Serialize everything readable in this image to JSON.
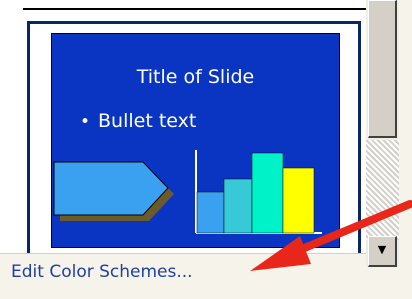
{
  "slide_thumbnail": {
    "title": "Title of Slide",
    "bullet_marker": "•",
    "bullet_text": "Bullet text"
  },
  "scrollbar": {
    "down_arrow_glyph": "▼"
  },
  "link": {
    "edit_color_schemes": "Edit Color Schemes..."
  },
  "colors": {
    "slide_background": "#0a35c2",
    "frame_selected": "#0a246a",
    "link": "#1f3fa8",
    "callout_arrow": "#e8271a",
    "chart_bar_1": "#3aa0f0",
    "chart_bar_2": "#37c9d8",
    "chart_bar_3": "#00f3c8",
    "chart_bar_4": "#ffff00",
    "pentagon_fill": "#3aa0f0",
    "pentagon_shadow": "#6b5a2a"
  }
}
